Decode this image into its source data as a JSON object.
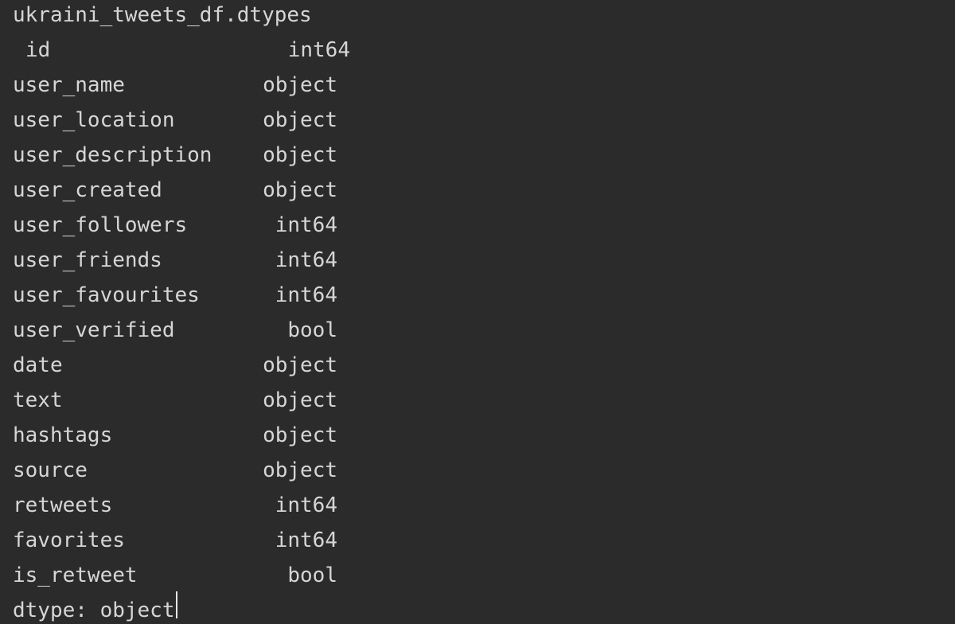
{
  "command": "ukraini_tweets_df.dtypes",
  "rows": [
    {
      "name": "id",
      "dtype": "int64"
    },
    {
      "name": "user_name",
      "dtype": "object"
    },
    {
      "name": "user_location",
      "dtype": "object"
    },
    {
      "name": "user_description",
      "dtype": "object"
    },
    {
      "name": "user_created",
      "dtype": "object"
    },
    {
      "name": "user_followers",
      "dtype": "int64"
    },
    {
      "name": "user_friends",
      "dtype": "int64"
    },
    {
      "name": "user_favourites",
      "dtype": "int64"
    },
    {
      "name": "user_verified",
      "dtype": "bool"
    },
    {
      "name": "date",
      "dtype": "object"
    },
    {
      "name": "text",
      "dtype": "object"
    },
    {
      "name": "hashtags",
      "dtype": "object"
    },
    {
      "name": "source",
      "dtype": "object"
    },
    {
      "name": "retweets",
      "dtype": "int64"
    },
    {
      "name": "favorites",
      "dtype": "int64"
    },
    {
      "name": "is_retweet",
      "dtype": "bool"
    }
  ],
  "footer": "dtype: object"
}
